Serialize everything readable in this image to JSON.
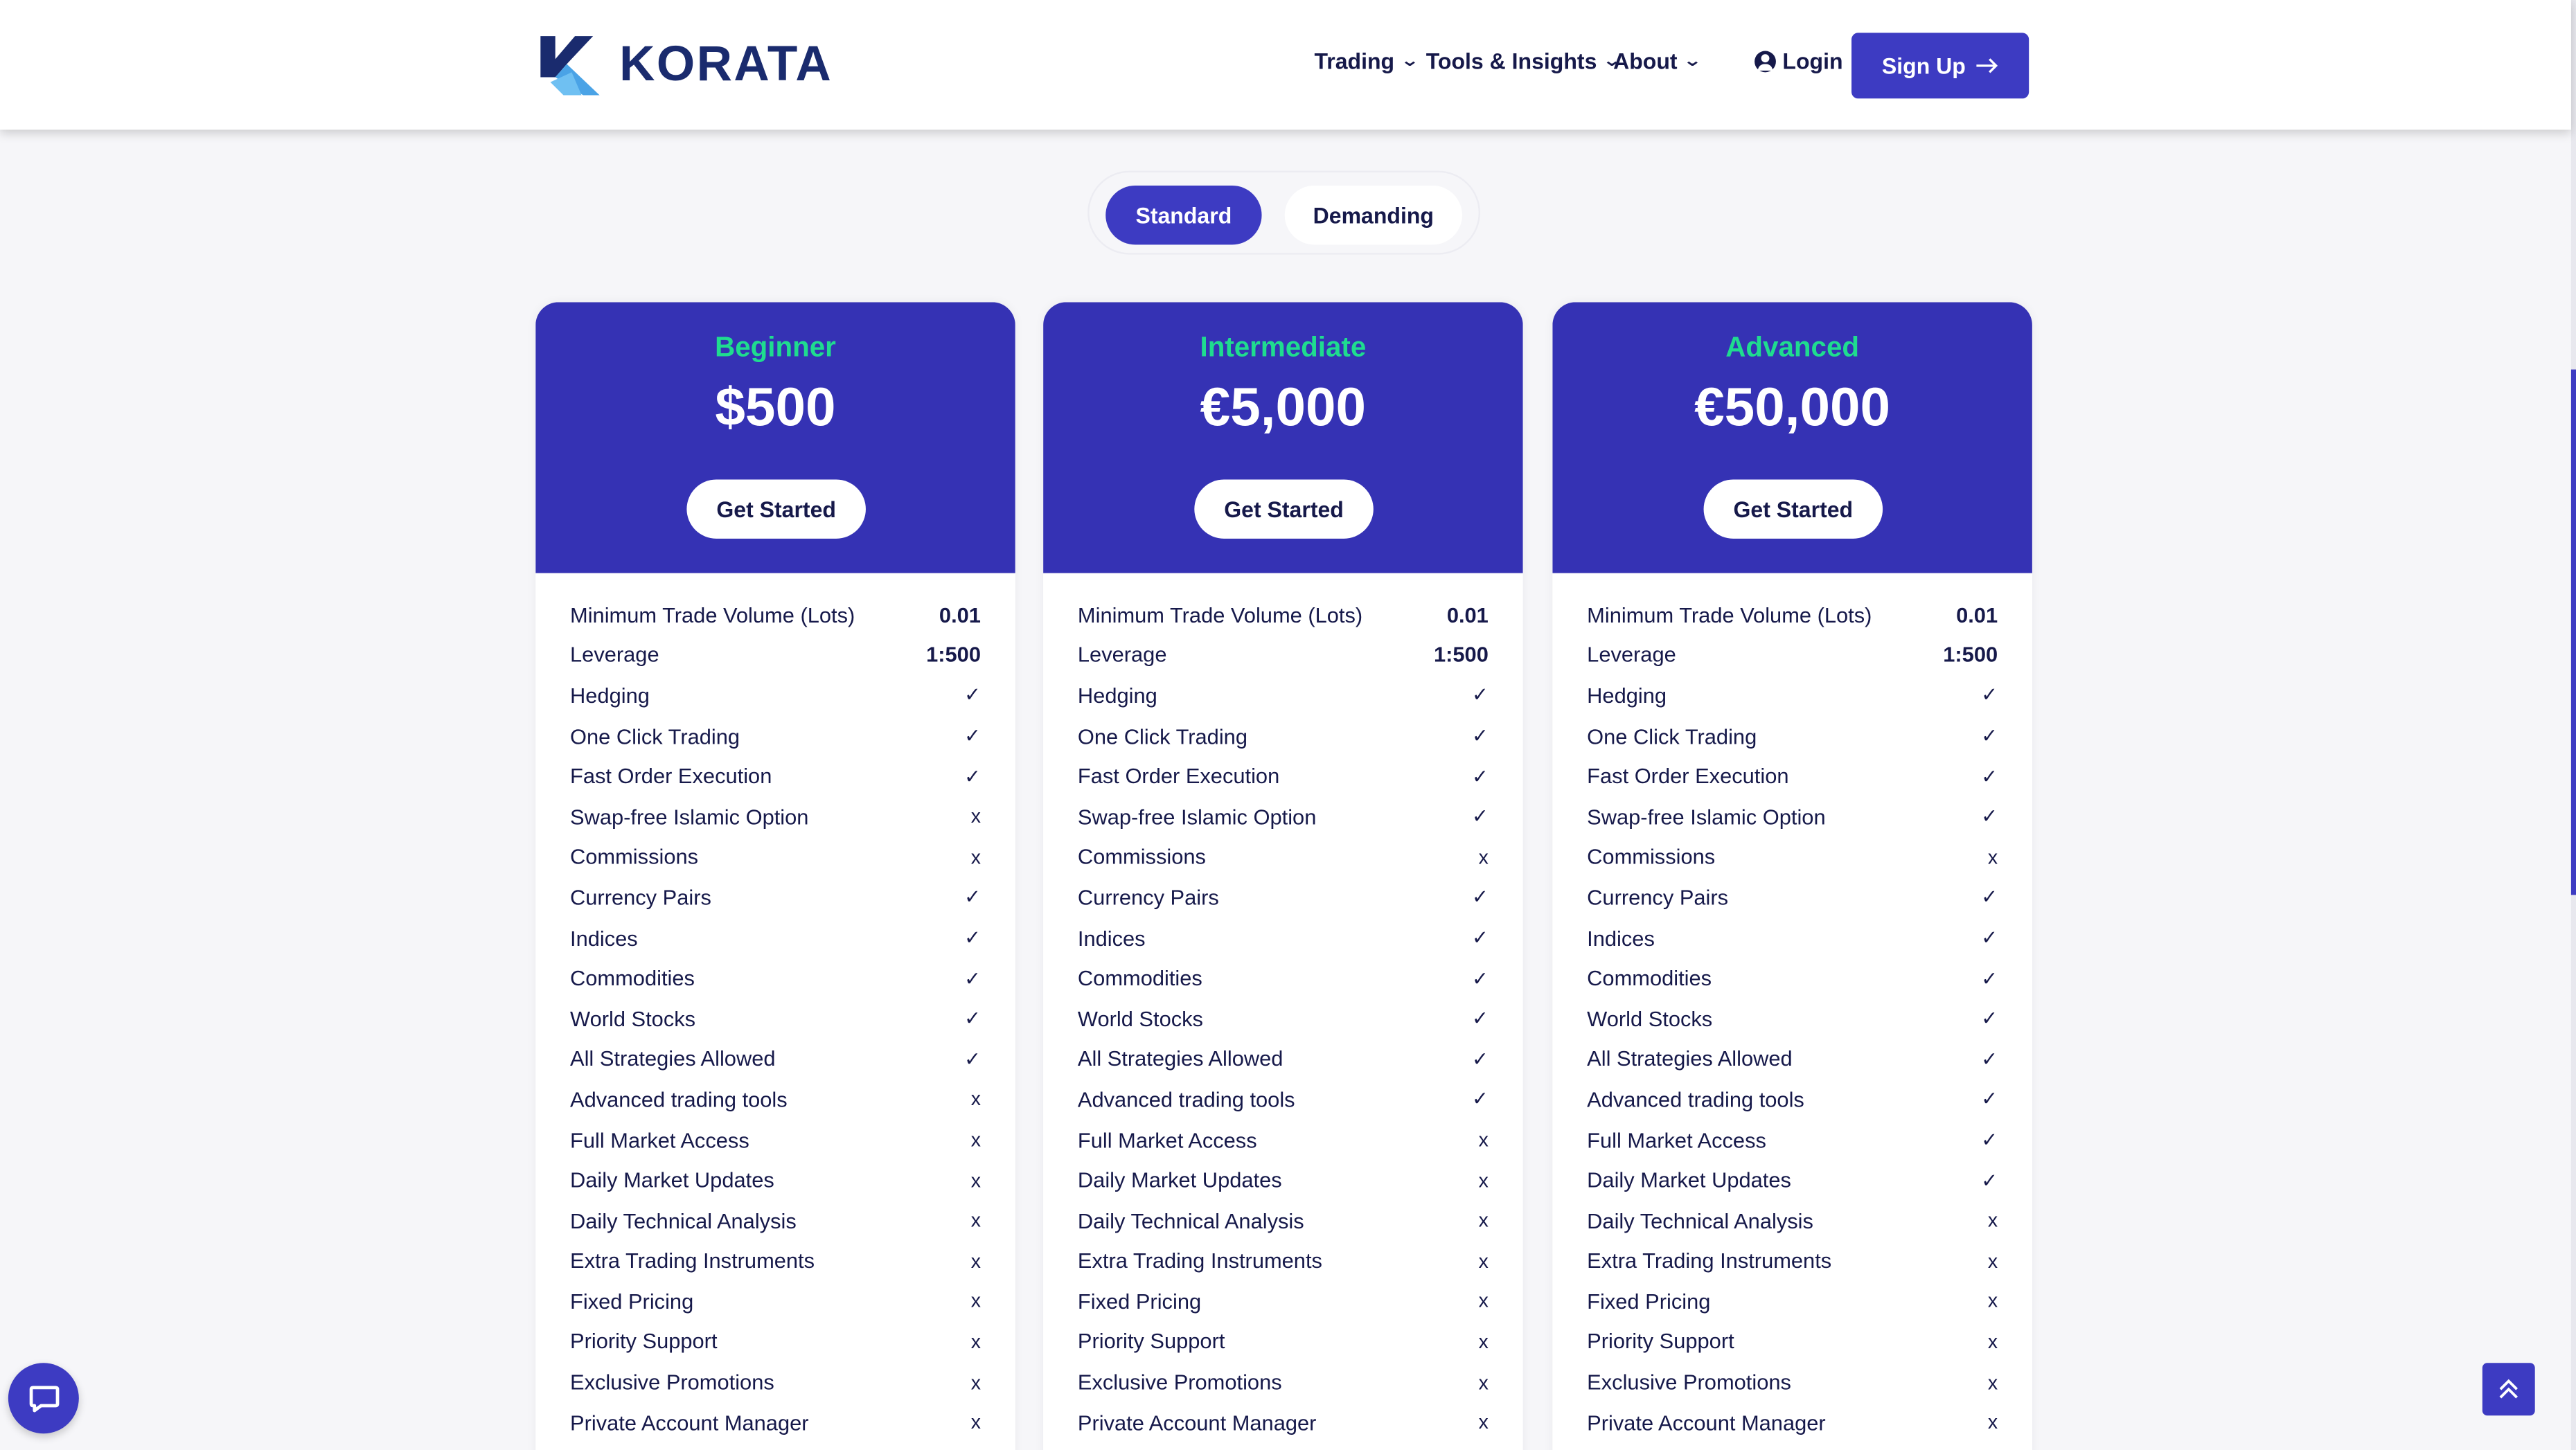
{
  "brand": {
    "name": "KORATA"
  },
  "nav": {
    "items": [
      "Trading",
      "Tools & Insights",
      "About"
    ],
    "login": "Login",
    "signup": "Sign Up"
  },
  "toggle": {
    "active": "Standard",
    "inactive": "Demanding"
  },
  "plans": [
    {
      "tier": "Beginner",
      "price": "$500",
      "cta": "Get Started",
      "features": [
        [
          "Minimum Trade Volume (Lots)",
          "0.01"
        ],
        [
          "Leverage",
          "1:500"
        ],
        [
          "Hedging",
          "✓"
        ],
        [
          "One Click Trading",
          "✓"
        ],
        [
          "Fast Order Execution",
          "✓"
        ],
        [
          "Swap-free Islamic Option",
          "x"
        ],
        [
          "Commissions",
          "x"
        ],
        [
          "Currency Pairs",
          "✓"
        ],
        [
          "Indices",
          "✓"
        ],
        [
          "Commodities",
          "✓"
        ],
        [
          "World Stocks",
          "✓"
        ],
        [
          "All Strategies Allowed",
          "✓"
        ],
        [
          "Advanced trading tools",
          "x"
        ],
        [
          "Full Market Access",
          "x"
        ],
        [
          "Daily Market Updates",
          "x"
        ],
        [
          "Daily Technical Analysis",
          "x"
        ],
        [
          "Extra Trading Instruments",
          "x"
        ],
        [
          "Fixed Pricing",
          "x"
        ],
        [
          "Priority Support",
          "x"
        ],
        [
          "Exclusive Promotions",
          "x"
        ],
        [
          "Private Account Manager",
          "x"
        ]
      ]
    },
    {
      "tier": "Intermediate",
      "price": "€5,000",
      "cta": "Get Started",
      "features": [
        [
          "Minimum Trade Volume (Lots)",
          "0.01"
        ],
        [
          "Leverage",
          "1:500"
        ],
        [
          "Hedging",
          "✓"
        ],
        [
          "One Click Trading",
          "✓"
        ],
        [
          "Fast Order Execution",
          "✓"
        ],
        [
          "Swap-free Islamic Option",
          "✓"
        ],
        [
          "Commissions",
          "x"
        ],
        [
          "Currency Pairs",
          "✓"
        ],
        [
          "Indices",
          "✓"
        ],
        [
          "Commodities",
          "✓"
        ],
        [
          "World Stocks",
          "✓"
        ],
        [
          "All Strategies Allowed",
          "✓"
        ],
        [
          "Advanced trading tools",
          "✓"
        ],
        [
          "Full Market Access",
          "x"
        ],
        [
          "Daily Market Updates",
          "x"
        ],
        [
          "Daily Technical Analysis",
          "x"
        ],
        [
          "Extra Trading Instruments",
          "x"
        ],
        [
          "Fixed Pricing",
          "x"
        ],
        [
          "Priority Support",
          "x"
        ],
        [
          "Exclusive Promotions",
          "x"
        ],
        [
          "Private Account Manager",
          "x"
        ]
      ]
    },
    {
      "tier": "Advanced",
      "price": "€50,000",
      "cta": "Get Started",
      "features": [
        [
          "Minimum Trade Volume (Lots)",
          "0.01"
        ],
        [
          "Leverage",
          "1:500"
        ],
        [
          "Hedging",
          "✓"
        ],
        [
          "One Click Trading",
          "✓"
        ],
        [
          "Fast Order Execution",
          "✓"
        ],
        [
          "Swap-free Islamic Option",
          "✓"
        ],
        [
          "Commissions",
          "x"
        ],
        [
          "Currency Pairs",
          "✓"
        ],
        [
          "Indices",
          "✓"
        ],
        [
          "Commodities",
          "✓"
        ],
        [
          "World Stocks",
          "✓"
        ],
        [
          "All Strategies Allowed",
          "✓"
        ],
        [
          "Advanced trading tools",
          "✓"
        ],
        [
          "Full Market Access",
          "✓"
        ],
        [
          "Daily Market Updates",
          "✓"
        ],
        [
          "Daily Technical Analysis",
          "x"
        ],
        [
          "Extra Trading Instruments",
          "x"
        ],
        [
          "Fixed Pricing",
          "x"
        ],
        [
          "Priority Support",
          "x"
        ],
        [
          "Exclusive Promotions",
          "x"
        ],
        [
          "Private Account Manager",
          "x"
        ]
      ]
    }
  ],
  "colors": {
    "primary": "#3d3bc2",
    "card_header": "#3532b4",
    "tier_accent": "#1fdc8f",
    "text_dark": "#16194a"
  },
  "icons": [
    "chat-icon",
    "arrow-up-icon",
    "user-icon",
    "arrow-right-icon",
    "chevron-down-icon"
  ]
}
